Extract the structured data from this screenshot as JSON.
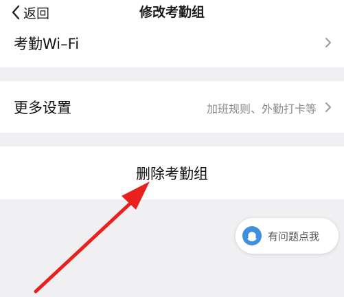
{
  "nav": {
    "back_label": "返回",
    "title": "修改考勤组"
  },
  "settings": {
    "wifi_label": "考勤Wi–Fi",
    "more_label": "更多设置",
    "more_hint": "加班规则、外勤打卡等"
  },
  "danger": {
    "delete_label": "删除考勤组"
  },
  "help": {
    "label": "有问题点我"
  },
  "colors": {
    "annotation_arrow": "#e8211e",
    "help_icon": "#3d8fe0"
  }
}
